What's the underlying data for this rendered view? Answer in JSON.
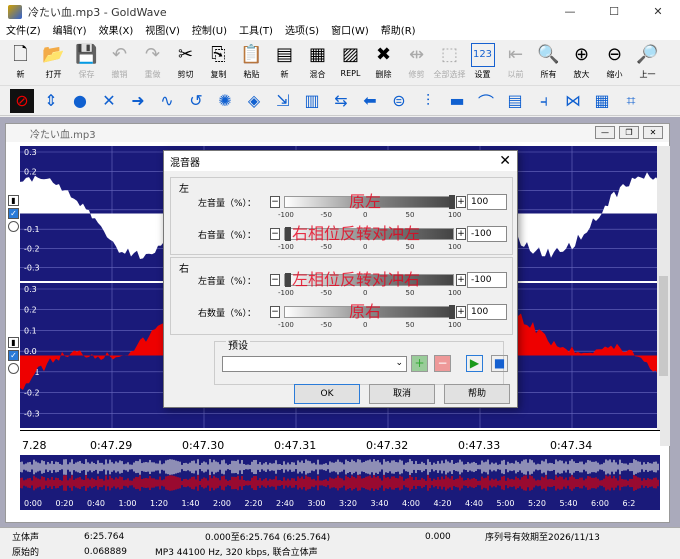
{
  "window": {
    "title": "冷たい血.mp3 - GoldWave",
    "minimize": "—",
    "maximize": "☐",
    "close": "✕"
  },
  "menu": [
    "文件(Z)",
    "编辑(Y)",
    "效果(X)",
    "视图(V)",
    "控制(U)",
    "工具(T)",
    "选项(S)",
    "窗口(W)",
    "帮助(R)"
  ],
  "toolbar1": [
    {
      "label": "新",
      "icon": "new-file-icon",
      "glyph": "🗋",
      "disabled": false
    },
    {
      "label": "打开",
      "icon": "open-folder-icon",
      "glyph": "📂",
      "disabled": false
    },
    {
      "label": "保存",
      "icon": "save-icon",
      "glyph": "💾",
      "disabled": true
    },
    {
      "label": "撤销",
      "icon": "undo-icon",
      "glyph": "↶",
      "disabled": true
    },
    {
      "label": "重做",
      "icon": "redo-icon",
      "glyph": "↷",
      "disabled": true
    },
    {
      "label": "剪切",
      "icon": "cut-icon",
      "glyph": "✂",
      "disabled": false
    },
    {
      "label": "复制",
      "icon": "copy-icon",
      "glyph": "⎘",
      "disabled": false
    },
    {
      "label": "粘贴",
      "icon": "paste-icon",
      "glyph": "📋",
      "disabled": false
    },
    {
      "label": "新",
      "icon": "paste-new-icon",
      "glyph": "▤",
      "disabled": false
    },
    {
      "label": "混合",
      "icon": "mix-icon",
      "glyph": "▦",
      "disabled": false
    },
    {
      "label": "REPL",
      "icon": "replace-icon",
      "glyph": "▨",
      "disabled": false
    },
    {
      "label": "删除",
      "icon": "delete-icon",
      "glyph": "✖",
      "disabled": false
    },
    {
      "label": "修剪",
      "icon": "trim-icon",
      "glyph": "⇹",
      "disabled": true
    },
    {
      "label": "全部选择",
      "icon": "select-all-icon",
      "glyph": "⬚",
      "disabled": true
    },
    {
      "label": "设置",
      "icon": "set-icon",
      "glyph": "123",
      "disabled": false
    },
    {
      "label": "以前",
      "icon": "previous-icon",
      "glyph": "⇤",
      "disabled": true
    },
    {
      "label": "所有",
      "icon": "zoom-all-icon",
      "glyph": "🔍",
      "disabled": false
    },
    {
      "label": "放大",
      "icon": "zoom-in-icon",
      "glyph": "⊕",
      "disabled": false
    },
    {
      "label": "缩小",
      "icon": "zoom-out-icon",
      "glyph": "⊖",
      "disabled": false
    },
    {
      "label": "上一",
      "icon": "zoom-previous-icon",
      "glyph": "🔎",
      "disabled": false
    }
  ],
  "toolbar2_icons": [
    "no-sign-icon",
    "vertical-arrows-icon",
    "sphere-icon",
    "crossed-tools-icon",
    "right-arrow-icon",
    "wave-icon",
    "loop-back-icon",
    "gear-icon",
    "color-cube-icon",
    "expand-icon",
    "equalizer-icon",
    "bidirectional-icon",
    "left-arrow-icon",
    "vertical-center-icon",
    "sliders-icon",
    "gradient-bar-icon",
    "arch-icon",
    "rainbow-icon",
    "split-icon",
    "crossfade-icon",
    "spectrum-icon",
    "envelope-icon"
  ],
  "toolbar2_glyphs": [
    "⊘",
    "⇕",
    "●",
    "✕",
    "➜",
    "∿",
    "↺",
    "✺",
    "◈",
    "⇲",
    "▥",
    "⇆",
    "⬅",
    "⊜",
    "⫶",
    "▬",
    "⌒",
    "▤",
    "⫞",
    "⋈",
    "▦",
    "⌗"
  ],
  "document": {
    "title": "冷たい血.mp3"
  },
  "left_channel_labels": [
    "0.3",
    "0.2",
    "0.1",
    "0.0",
    "-0.1",
    "-0.2",
    "-0.3"
  ],
  "right_channel_labels": [
    "0.3",
    "0.2",
    "0.1",
    "0.0",
    "-0.1",
    "-0.2",
    "-0.3"
  ],
  "ruler": [
    "7.28",
    "0:47.29",
    "0:47.30",
    "0:47.31",
    "0:47.32",
    "0:47.33",
    "0:47.34"
  ],
  "overview_ruler": [
    "0:00",
    "0:20",
    "0:40",
    "1:00",
    "1:20",
    "1:40",
    "2:00",
    "2:20",
    "2:40",
    "3:00",
    "3:20",
    "3:40",
    "4:00",
    "4:20",
    "4:40",
    "5:00",
    "5:20",
    "5:40",
    "6:00",
    "6:2"
  ],
  "colors": {
    "waveform_bg": "#1a1a7a",
    "left_wave": "#ffffff",
    "right_wave": "#ee0000",
    "overlay_text": "#e8001c"
  },
  "dialog": {
    "title": "混音器",
    "close": "✕",
    "left_group": "左",
    "right_group": "右",
    "rows": [
      {
        "label": "左音量（%）：",
        "value": "100",
        "overlay": "原左",
        "level": 100
      },
      {
        "label": "右音量（%）：",
        "value": "-100",
        "overlay": "右相位反转对冲左",
        "level": -100
      },
      {
        "label": "左音量（%）：",
        "value": "-100",
        "overlay": "左相位反转对冲右",
        "level": -100
      },
      {
        "label": "右数量（%）：",
        "value": "100",
        "overlay": "原右",
        "level": 100
      }
    ],
    "scale": [
      "-100",
      "-50",
      "0",
      "50",
      "100"
    ],
    "preset_label": "预设",
    "ok": "OK",
    "cancel": "取消",
    "help": "帮助"
  },
  "status": {
    "row1": [
      "立体声",
      "6:25.764",
      "0.000至6:25.764 (6:25.764)",
      "0.000",
      "序列号有效期至2026/11/13"
    ],
    "row2": [
      "原始的",
      "0.068889",
      "MP3 44100 Hz, 320 kbps, 联合立体声"
    ]
  }
}
